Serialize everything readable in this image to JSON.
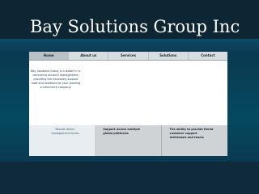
{
  "site": {
    "title": "Bay Solutions Group Inc"
  },
  "nav": {
    "items": [
      {
        "label": "Home",
        "active": true
      },
      {
        "label": "About us",
        "active": false
      },
      {
        "label": "Services",
        "active": false
      },
      {
        "label": "Solutions",
        "active": false
      },
      {
        "label": "Contact",
        "active": false
      }
    ]
  },
  "main": {
    "intro": "Bay Solutions Group is a leader in e-commerce account management, providing the necessary support staff and solutions for your growing e-commerce company."
  },
  "features": [
    {
      "text": "Results driven management teams"
    },
    {
      "text": "Support across multiple global platforms"
    },
    {
      "text": "The ability to provide tiered customer support individuals and teams"
    }
  ],
  "colors": {
    "header_bg": "#0e2533",
    "band_bg": "#0a3a52",
    "nav_bg": "#d8dde0",
    "nav_active_bg": "#b9c1c6",
    "content_bg": "#ffffff",
    "intro_text": "#1a3550"
  }
}
